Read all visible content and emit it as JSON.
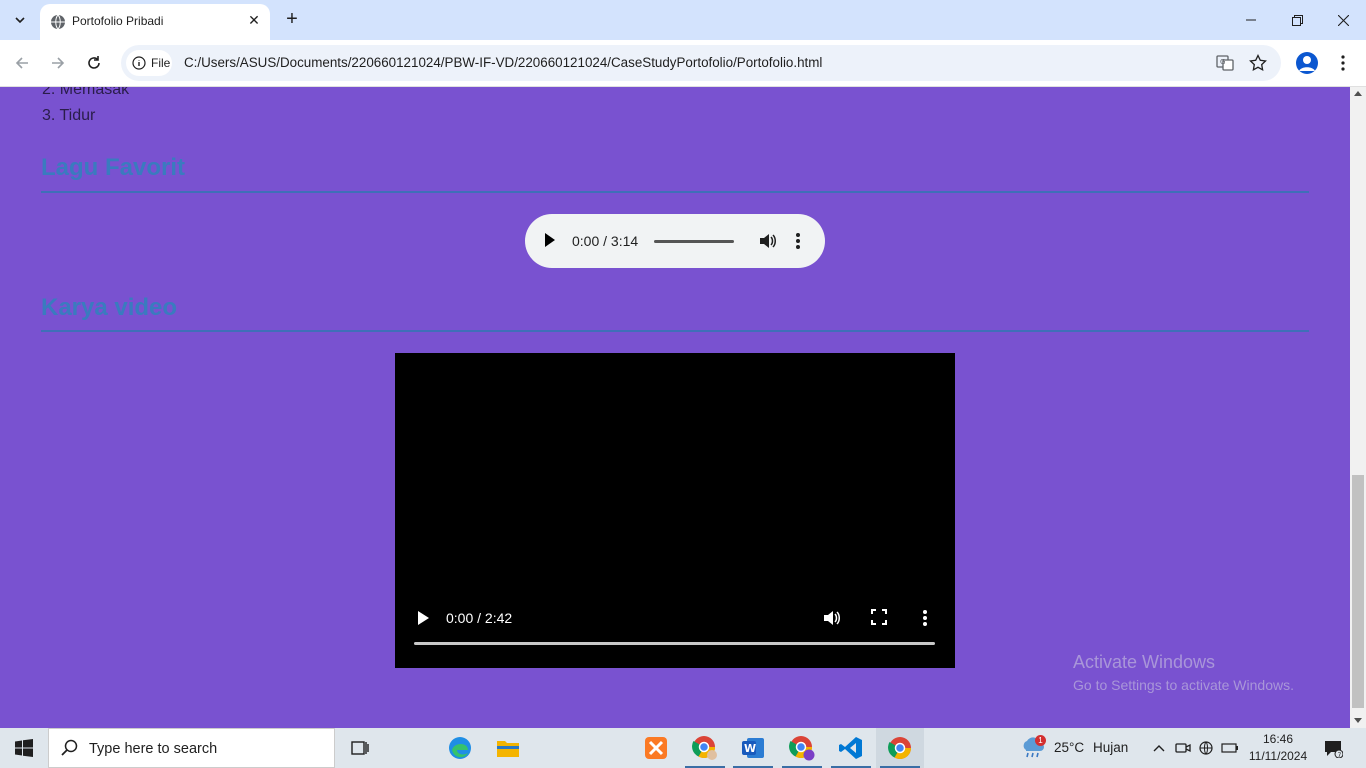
{
  "browser": {
    "tab_title": "Portofolio Pribadi",
    "omnibox_chip": "File",
    "url": "C:/Users/ASUS/Documents/220660121024/PBW-IF-VD/220660121024/CaseStudyPortofolio/Portofolio.html"
  },
  "page": {
    "hobbies": [
      "2. Memasak",
      "3. Tidur"
    ],
    "section_song": "Lagu Favorit",
    "audio_time": "0:00 / 3:14",
    "section_video": "Karya video",
    "video_time": "0:00 / 2:42",
    "background_color": "#7952d0",
    "heading_color": "#3a7bbf"
  },
  "watermark": {
    "line1": "Activate Windows",
    "line2": "Go to Settings to activate Windows."
  },
  "taskbar": {
    "search_placeholder": "Type here to search",
    "weather_temp": "25°C",
    "weather_condition": "Hujan",
    "weather_badge": "1",
    "time": "16:46",
    "date": "11/11/2024"
  }
}
